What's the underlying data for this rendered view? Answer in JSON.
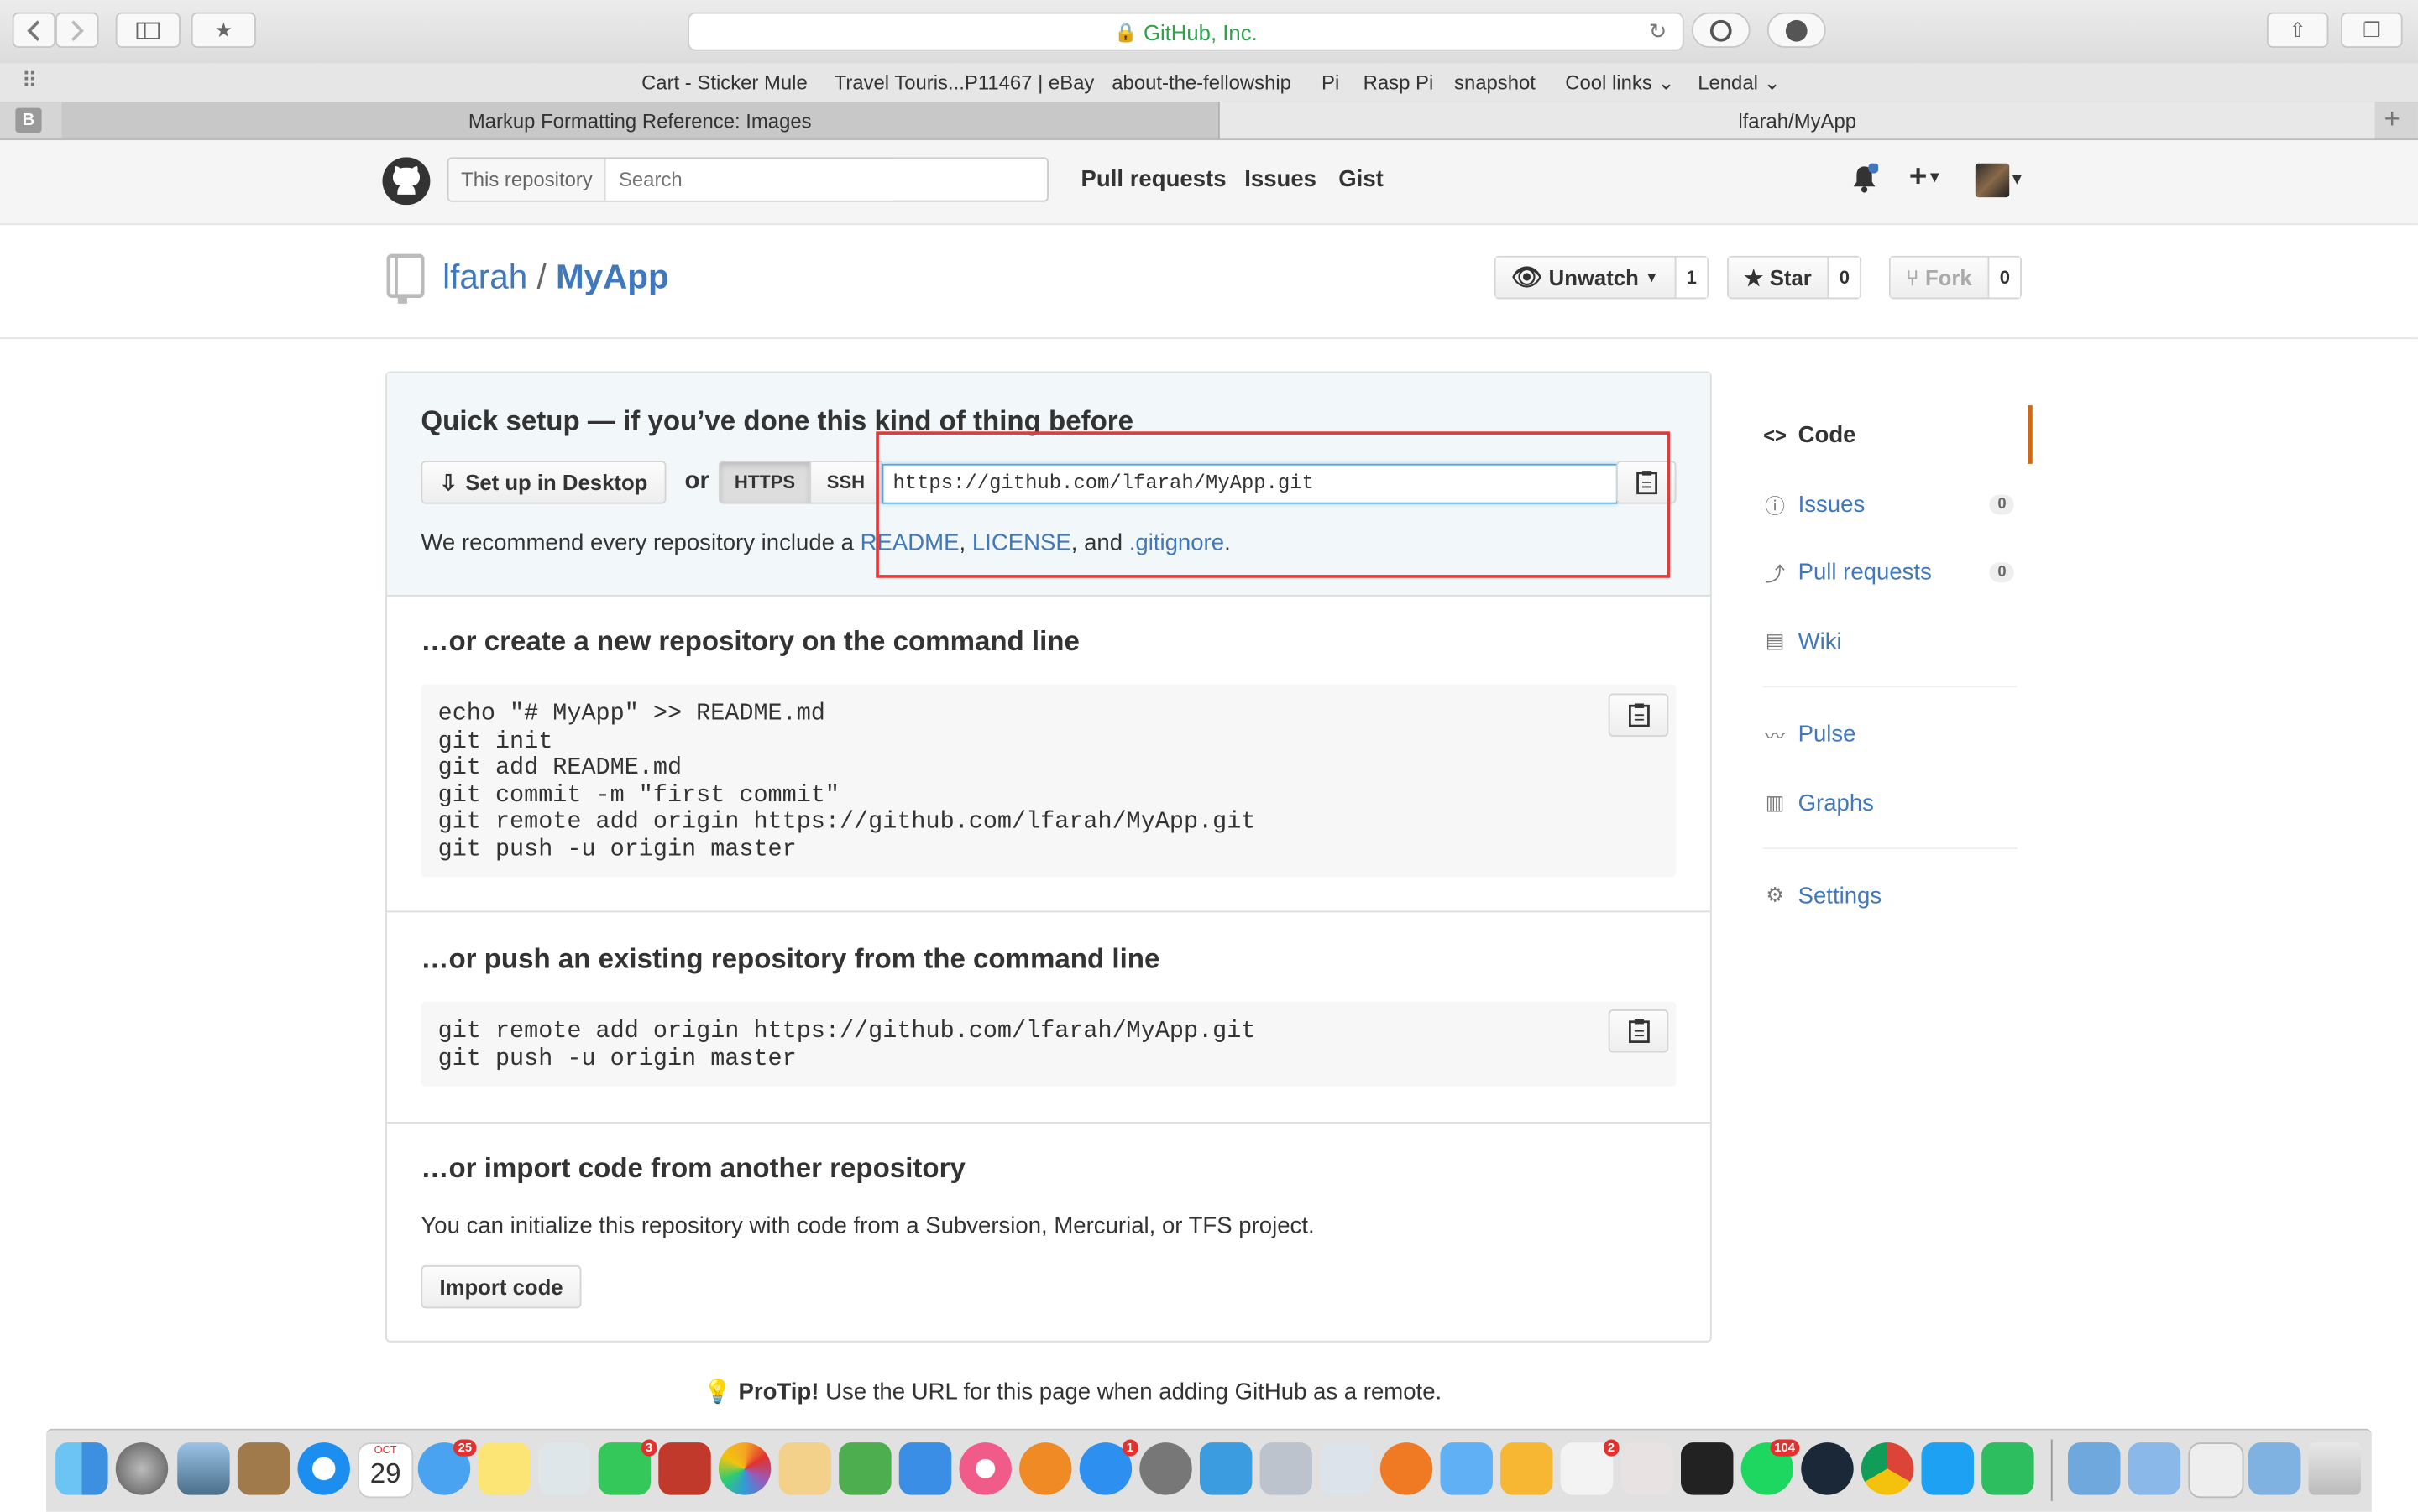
{
  "browser": {
    "url_title": "GitHub, Inc.",
    "favorites": [
      "Cart - Sticker Mule",
      "Travel Touris...P11467 | eBay",
      "about-the-fellowship",
      "Pi",
      "Rasp Pi",
      "snapshot",
      "Cool links",
      "Lendal"
    ],
    "tabs": [
      "Markup Formatting Reference: Images",
      "lfarah/MyApp"
    ],
    "tab_icon_letter": "B"
  },
  "header": {
    "search_scope": "This repository",
    "search_placeholder": "Search",
    "nav": [
      "Pull requests",
      "Issues",
      "Gist"
    ]
  },
  "repo": {
    "owner": "lfarah",
    "separator": "/",
    "name": "MyApp",
    "watch_label": "Unwatch",
    "watch_count": "1",
    "star_label": "Star",
    "star_count": "0",
    "fork_label": "Fork",
    "fork_count": "0"
  },
  "quick_setup": {
    "title": "Quick setup — if you’ve done this kind of thing before",
    "desktop_button": "Set up in Desktop",
    "or": "or",
    "https": "HTTPS",
    "ssh": "SSH",
    "clone_url": "https://github.com/lfarah/MyApp.git",
    "recommend_prefix": "We recommend every repository include a",
    "readme": "README",
    "comma": ",",
    "license": "LICENSE",
    "and": ", and",
    "gitignore": ".gitignore",
    "period": "."
  },
  "new_repo": {
    "title": "…or create a new repository on the command line",
    "code": "echo \"# MyApp\" >> README.md\ngit init\ngit add README.md\ngit commit -m \"first commit\"\ngit remote add origin https://github.com/lfarah/MyApp.git\ngit push -u origin master"
  },
  "push_existing": {
    "title": "…or push an existing repository from the command line",
    "code": "git remote add origin https://github.com/lfarah/MyApp.git\ngit push -u origin master"
  },
  "import": {
    "title": "…or import code from another repository",
    "text": "You can initialize this repository with code from a Subversion, Mercurial, or TFS project.",
    "button": "Import code"
  },
  "protip": {
    "label": "ProTip!",
    "text": "Use the URL for this page when adding GitHub as a remote."
  },
  "sidebar": {
    "items": [
      {
        "label": "Code",
        "icon": "code-icon"
      },
      {
        "label": "Issues",
        "icon": "issue-icon",
        "count": "0"
      },
      {
        "label": "Pull requests",
        "icon": "pull-request-icon",
        "count": "0"
      },
      {
        "label": "Wiki",
        "icon": "book-icon"
      },
      {
        "label": "Pulse",
        "icon": "pulse-icon"
      },
      {
        "label": "Graphs",
        "icon": "graph-icon"
      },
      {
        "label": "Settings",
        "icon": "gear-icon"
      }
    ]
  },
  "dock": {
    "calendar_day": "29",
    "calendar_month": "OCT",
    "badges": [
      "25",
      "3",
      "1",
      "2",
      "104"
    ]
  },
  "colors": {
    "link": "#4078c0",
    "highlight": "#e03c3c",
    "accent": "#d26911"
  }
}
